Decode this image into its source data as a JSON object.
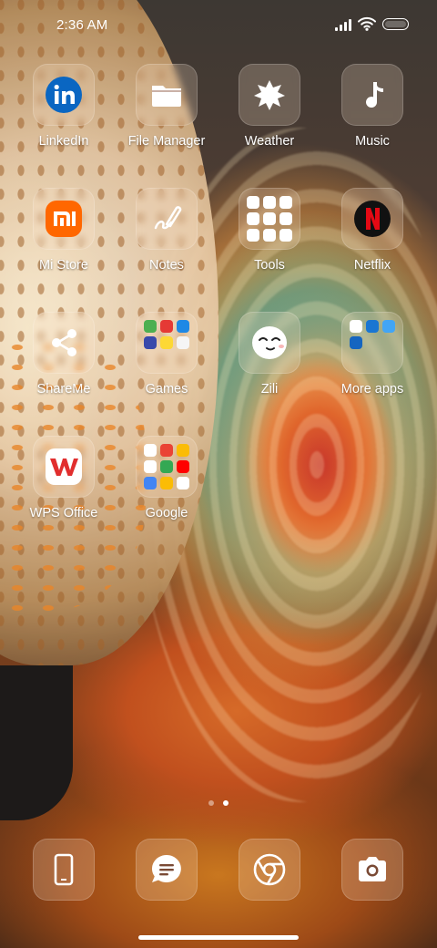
{
  "status": {
    "time": "2:36 AM"
  },
  "apps": [
    {
      "id": "linkedin",
      "label": "LinkedIn"
    },
    {
      "id": "file_manager",
      "label": "File Manager"
    },
    {
      "id": "weather",
      "label": "Weather"
    },
    {
      "id": "music",
      "label": "Music"
    },
    {
      "id": "mi_store",
      "label": "Mi Store"
    },
    {
      "id": "notes",
      "label": "Notes"
    },
    {
      "id": "tools",
      "label": "Tools"
    },
    {
      "id": "netflix",
      "label": "Netflix"
    },
    {
      "id": "shareme",
      "label": "ShareMe"
    },
    {
      "id": "games",
      "label": "Games"
    },
    {
      "id": "zili",
      "label": "Zili"
    },
    {
      "id": "more_apps",
      "label": "More apps"
    },
    {
      "id": "wps_office",
      "label": "WPS Office"
    },
    {
      "id": "google",
      "label": "Google"
    }
  ],
  "dock": [
    {
      "id": "phone",
      "icon": "phone-icon"
    },
    {
      "id": "messages",
      "icon": "messages-icon"
    },
    {
      "id": "chrome",
      "icon": "chrome-icon"
    },
    {
      "id": "camera",
      "icon": "camera-icon"
    }
  ],
  "page_indicator": {
    "pages": 2,
    "active": 2
  },
  "colors": {
    "linkedin": "#0a66c2",
    "mi_store": "#ff6700",
    "netflix": "#e50914",
    "wps": "#e12e2e"
  }
}
